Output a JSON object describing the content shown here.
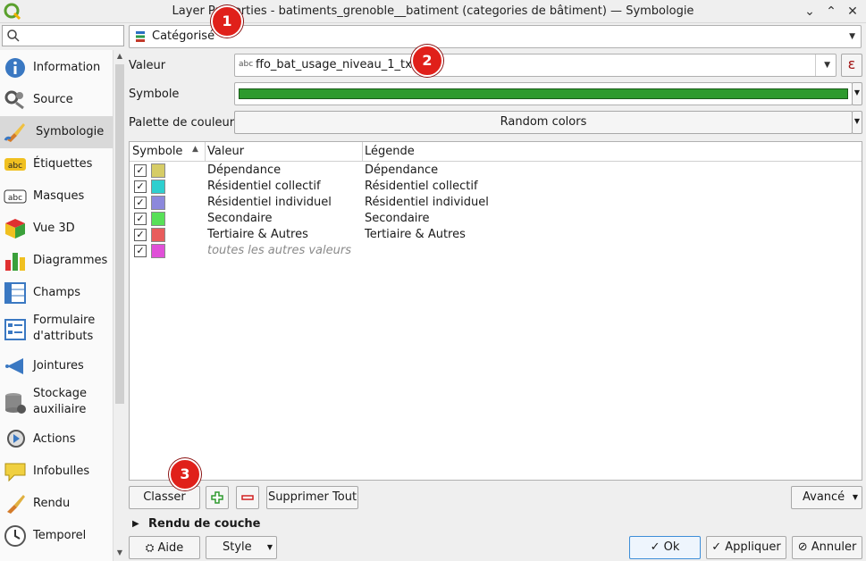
{
  "window": {
    "title": "Layer Properties - batiments_grenoble__batiment (categories de bâtiment) — Symbologie"
  },
  "sidebar": {
    "search_placeholder": "",
    "items": [
      {
        "label": "Information",
        "icon": "info-icon"
      },
      {
        "label": "Source",
        "icon": "source-icon"
      },
      {
        "label": "Symbologie",
        "icon": "paintbrush-icon",
        "active": true
      },
      {
        "label": "Étiquettes",
        "icon": "labels-icon"
      },
      {
        "label": "Masques",
        "icon": "masks-icon"
      },
      {
        "label": "Vue 3D",
        "icon": "cube-icon"
      },
      {
        "label": "Diagrammes",
        "icon": "diagram-icon"
      },
      {
        "label": "Champs",
        "icon": "fields-icon"
      },
      {
        "label": "Formulaire d'attributs",
        "icon": "form-icon"
      },
      {
        "label": "Jointures",
        "icon": "joins-icon"
      },
      {
        "label": "Stockage auxiliaire",
        "icon": "storage-icon"
      },
      {
        "label": "Actions",
        "icon": "actions-icon"
      },
      {
        "label": "Infobulles",
        "icon": "tooltip-icon"
      },
      {
        "label": "Rendu",
        "icon": "render-icon"
      },
      {
        "label": "Temporel",
        "icon": "clock-icon"
      }
    ]
  },
  "renderer": {
    "type_label": "Catégorisé"
  },
  "form": {
    "value_label": "Valeur",
    "value_field": "ffo_bat_usage_niveau_1_txt",
    "value_field_type": "abc",
    "symbol_label": "Symbole",
    "symbol_color": "#2e9a2e",
    "palette_label": "Palette de couleur",
    "palette_value": "Random colors"
  },
  "table": {
    "headers": {
      "symbol": "Symbole",
      "value": "Valeur",
      "legend": "Légende"
    },
    "rows": [
      {
        "checked": true,
        "color": "#d6cc66",
        "value": "Dépendance",
        "legend": "Dépendance"
      },
      {
        "checked": true,
        "color": "#2ecfcf",
        "value": "Résidentiel collectif",
        "legend": "Résidentiel collectif"
      },
      {
        "checked": true,
        "color": "#8c88dc",
        "value": "Résidentiel individuel",
        "legend": "Résidentiel individuel"
      },
      {
        "checked": true,
        "color": "#58e058",
        "value": "Secondaire",
        "legend": "Secondaire"
      },
      {
        "checked": true,
        "color": "#e85c5c",
        "value": "Tertiaire & Autres",
        "legend": "Tertiaire & Autres"
      },
      {
        "checked": true,
        "color": "#e050d8",
        "value": "toutes les autres valeurs",
        "legend": "",
        "italic": true
      }
    ]
  },
  "actions": {
    "classify": "Classer",
    "delete_all": "Supprimer Tout",
    "advanced": "Avancé",
    "layer_rendering": "Rendu de couche"
  },
  "footer": {
    "help": "Aide",
    "style": "Style",
    "ok": "Ok",
    "apply": "Appliquer",
    "cancel": "Annuler"
  },
  "annotations": [
    "1",
    "2",
    "3"
  ]
}
